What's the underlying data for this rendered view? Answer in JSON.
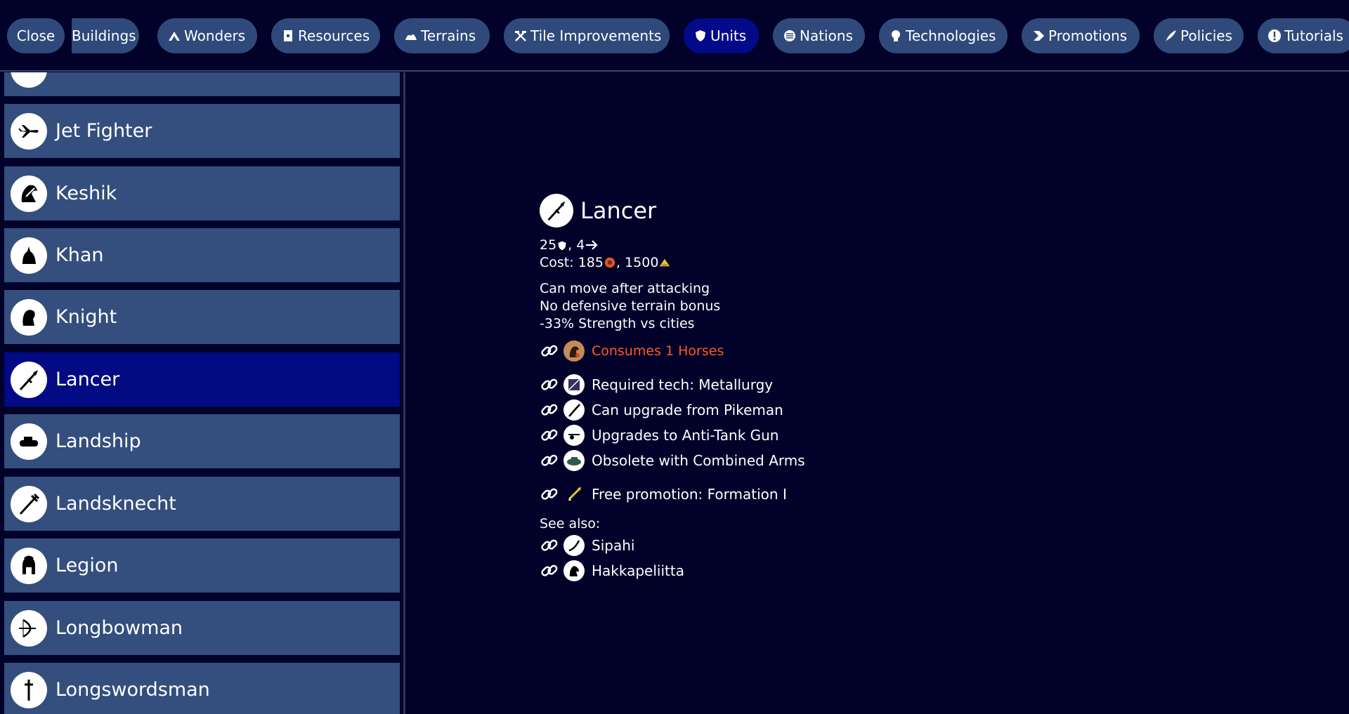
{
  "topbar": {
    "close_label": "Close",
    "categories": [
      {
        "label": "Buildings",
        "icon": "building-icon"
      },
      {
        "label": "Wonders",
        "icon": "wonder-icon"
      },
      {
        "label": "Resources",
        "icon": "resource-icon"
      },
      {
        "label": "Terrains",
        "icon": "terrain-icon"
      },
      {
        "label": "Tile Improvements",
        "icon": "hammer-icon"
      },
      {
        "label": "Units",
        "icon": "shield-icon",
        "selected": true
      },
      {
        "label": "Nations",
        "icon": "nation-icon"
      },
      {
        "label": "Technologies",
        "icon": "tech-icon"
      },
      {
        "label": "Promotions",
        "icon": "chevron-icon"
      },
      {
        "label": "Policies",
        "icon": "quill-icon"
      },
      {
        "label": "Tutorials",
        "icon": "exclamation-icon"
      }
    ]
  },
  "units_list": [
    {
      "name": "Jet Fighter",
      "icon": "jet-fighter-icon"
    },
    {
      "name": "Keshik",
      "icon": "keshik-icon"
    },
    {
      "name": "Khan",
      "icon": "khan-icon"
    },
    {
      "name": "Knight",
      "icon": "knight-icon"
    },
    {
      "name": "Lancer",
      "icon": "lancer-icon",
      "selected": true
    },
    {
      "name": "Landship",
      "icon": "landship-icon"
    },
    {
      "name": "Landsknecht",
      "icon": "landsknecht-icon"
    },
    {
      "name": "Legion",
      "icon": "legion-icon"
    },
    {
      "name": "Longbowman",
      "icon": "longbowman-icon"
    },
    {
      "name": "Longswordsman",
      "icon": "longswordsman-icon"
    }
  ],
  "detail": {
    "title": "Lancer",
    "strength": "25",
    "movement": "4",
    "cost_label": "Cost:",
    "production_cost": "185",
    "gold_cost": "1500",
    "abilities": [
      "Can move after attacking",
      "No defensive terrain bonus",
      "-33% Strength vs cities"
    ],
    "consumes": "Consumes 1 Horses",
    "links": [
      {
        "text": "Required tech: Metallurgy",
        "icon": "metallurgy-icon"
      },
      {
        "text": "Can upgrade from Pikeman",
        "icon": "pikeman-icon"
      },
      {
        "text": "Upgrades to Anti-Tank Gun",
        "icon": "anti-tank-gun-icon"
      },
      {
        "text": "Obsolete with Combined Arms",
        "icon": "combined-arms-icon"
      }
    ],
    "promotion": "Free promotion: Formation I",
    "see_also_label": "See also:",
    "see_also": [
      {
        "text": "Sipahi",
        "icon": "sipahi-icon"
      },
      {
        "text": "Hakkapeliitta",
        "icon": "hakkapeliitta-icon"
      }
    ]
  },
  "colors": {
    "background": "#01012a",
    "button": "#2f4a7a",
    "button_selected": "#020a8a",
    "row": "#344e7e",
    "row_selected": "#020a84",
    "warning_text": "#ff5a1e"
  }
}
